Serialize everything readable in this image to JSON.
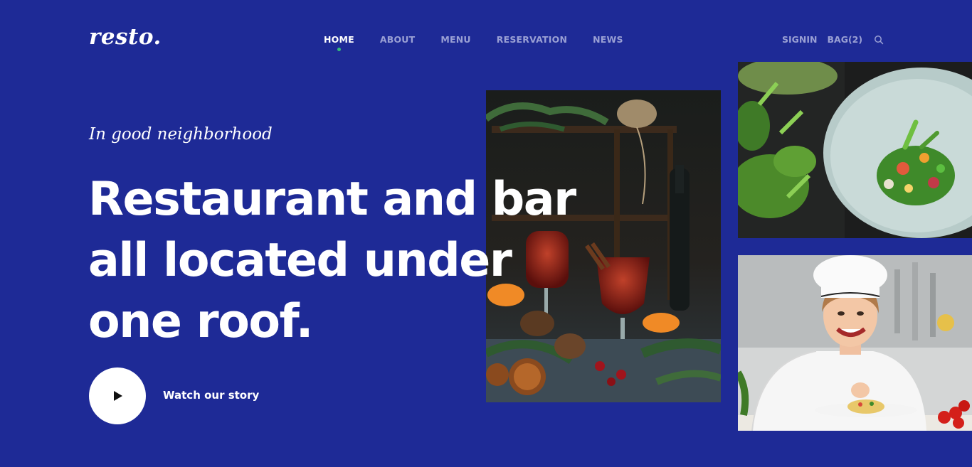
{
  "brand": {
    "logo": "resto."
  },
  "nav": {
    "items": [
      {
        "label": "HOME",
        "active": true
      },
      {
        "label": "ABOUT",
        "active": false
      },
      {
        "label": "MENU",
        "active": false
      },
      {
        "label": "RESERVATION",
        "active": false
      },
      {
        "label": "NEWS",
        "active": false
      }
    ]
  },
  "header_actions": {
    "signin": "SIGNIN",
    "bag": "BAG(2)",
    "search_icon": "search-icon"
  },
  "hero": {
    "tagline": "In good neighborhood",
    "headline_lines": [
      "Restaurant and bar",
      "all located under",
      "one roof."
    ],
    "cta_label": "Watch our story",
    "play_icon": "play-icon"
  },
  "colors": {
    "background": "#1e2a96",
    "nav_inactive": "#9aa0d4",
    "active_dot": "#35c07a",
    "text": "#ffffff"
  }
}
